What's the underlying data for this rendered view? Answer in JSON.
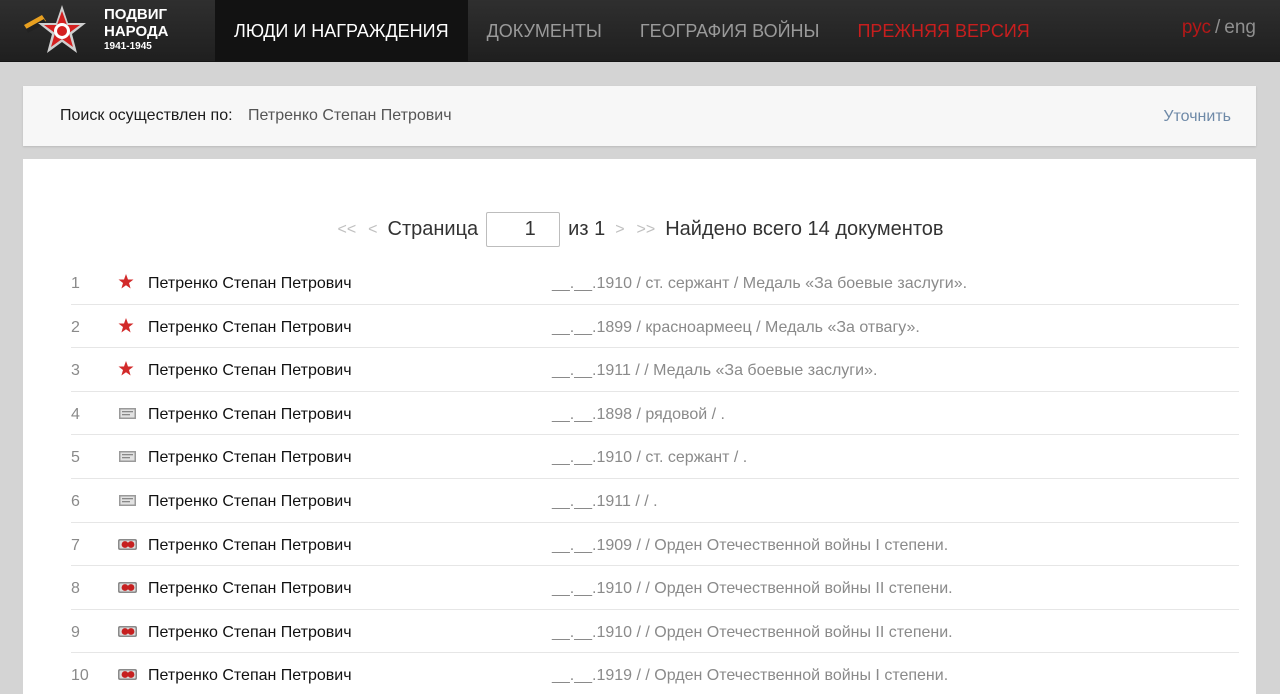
{
  "header": {
    "logo": {
      "line1": "ПОДВИГ",
      "line2": "НАРОДА",
      "years": "1941-1945"
    },
    "nav": [
      {
        "label": "ЛЮДИ И НАГРАЖДЕНИЯ",
        "active": true
      },
      {
        "label": "ДОКУМЕНТЫ"
      },
      {
        "label": "ГЕОГРАФИЯ ВОЙНЫ"
      },
      {
        "label": "ПРЕЖНЯЯ ВЕРСИЯ"
      }
    ],
    "lang": {
      "ru": "рус",
      "separator": "/",
      "en": "eng"
    }
  },
  "search": {
    "label": "Поиск осуществлен по:",
    "value": "Петренко Степан Петрович",
    "refine": "Уточнить"
  },
  "pager": {
    "first": "<<",
    "prev": "<",
    "page_word": "Страница",
    "current_page": "1",
    "of_word": "из 1",
    "next": ">",
    "last": ">>",
    "found": "Найдено всего 14 документов"
  },
  "results": [
    {
      "num": "1",
      "icon": "star-icon",
      "name": "Петренко Степан Петрович",
      "info": "__.__.1910 /  ст. сержант /  Медаль «За боевые заслуги»."
    },
    {
      "num": "2",
      "icon": "star-icon",
      "name": "Петренко Степан Петрович",
      "info": "__.__.1899 /  красноармеец /  Медаль «За отвагу»."
    },
    {
      "num": "3",
      "icon": "star-icon",
      "name": "Петренко Степан Петрович",
      "info": "__.__.1911 /   /  Медаль «За боевые заслуги»."
    },
    {
      "num": "4",
      "icon": "document-icon",
      "name": "Петренко Степан Петрович",
      "info": "__.__.1898 /  рядовой /  ."
    },
    {
      "num": "5",
      "icon": "document-icon",
      "name": "Петренко Степан Петрович",
      "info": "__.__.1910 /  ст. сержант /  ."
    },
    {
      "num": "6",
      "icon": "document-icon",
      "name": "Петренко Степан Петрович",
      "info": "__.__.1911 /   /  ."
    },
    {
      "num": "7",
      "icon": "order-icon",
      "name": "Петренко Степан Петрович",
      "info": "__.__.1909 /   /  Орден Отечественной войны I степени."
    },
    {
      "num": "8",
      "icon": "order-icon",
      "name": "Петренко Степан Петрович",
      "info": "__.__.1910 /   /  Орден Отечественной войны II степени."
    },
    {
      "num": "9",
      "icon": "order-icon",
      "name": "Петренко Степан Петрович",
      "info": "__.__.1910 /   /  Орден Отечественной войны II степени."
    },
    {
      "num": "10",
      "icon": "order-icon",
      "name": "Петренко Степан Петрович",
      "info": "__.__.1919 /   /  Орден Отечественной войны I степени."
    }
  ],
  "colors": {
    "accent_red": "#c81e1e",
    "link_blue": "#6f8aa8"
  }
}
